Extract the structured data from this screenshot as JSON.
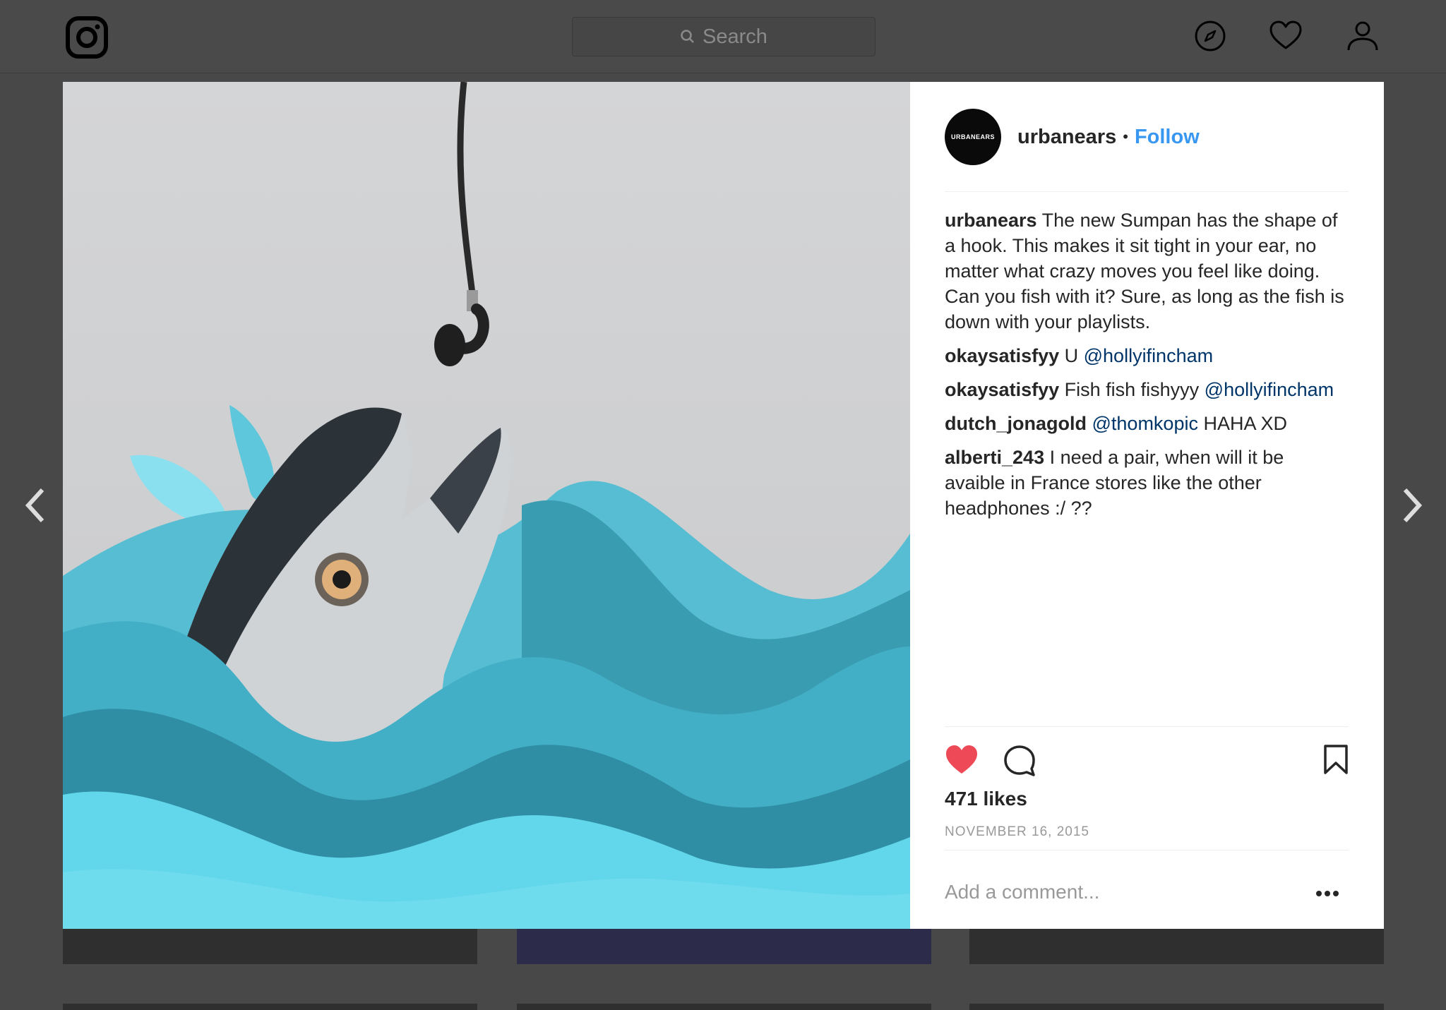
{
  "search": {
    "placeholder": "Search"
  },
  "post": {
    "avatar_text": "URBANEARS",
    "username": "urbanears",
    "follow_label": "Follow",
    "caption": {
      "user": "urbanears",
      "text": " The new Sumpan has the shape of a hook. This makes it sit tight in your ear, no matter what crazy moves you feel like doing. Can you fish with it? Sure, as long as the fish is down with your playlists."
    },
    "comments": [
      {
        "user": "okaysatisfyy",
        "pre": " U ",
        "mention": "@hollyifincham",
        "post": ""
      },
      {
        "user": "okaysatisfyy",
        "pre": " Fish fish fishyyy ",
        "mention": "@hollyifincham",
        "post": ""
      },
      {
        "user": "dutch_jonagold",
        "pre": " ",
        "mention": "@thomkopic",
        "post": " HAHA XD"
      },
      {
        "user": "alberti_243",
        "pre": " I need a pair, when will it be avaible in France stores like the other headphones :/ ??",
        "mention": "",
        "post": ""
      }
    ],
    "likes": "471 likes",
    "date": "NOVEMBER 16, 2015",
    "add_comment_placeholder": "Add a comment...",
    "liked": true
  },
  "colors": {
    "like_red": "#ed4956",
    "follow_blue": "#3897f0",
    "mention_blue": "#003569",
    "water_light": "#62d6eb",
    "water_dark": "#2a7d8f"
  },
  "icons": [
    "instagram-logo-icon",
    "search-icon",
    "explore-compass-icon",
    "activity-heart-icon",
    "profile-icon",
    "like-heart-icon",
    "comment-icon",
    "bookmark-icon",
    "more-options-icon",
    "chevron-left-icon",
    "chevron-right-icon"
  ]
}
